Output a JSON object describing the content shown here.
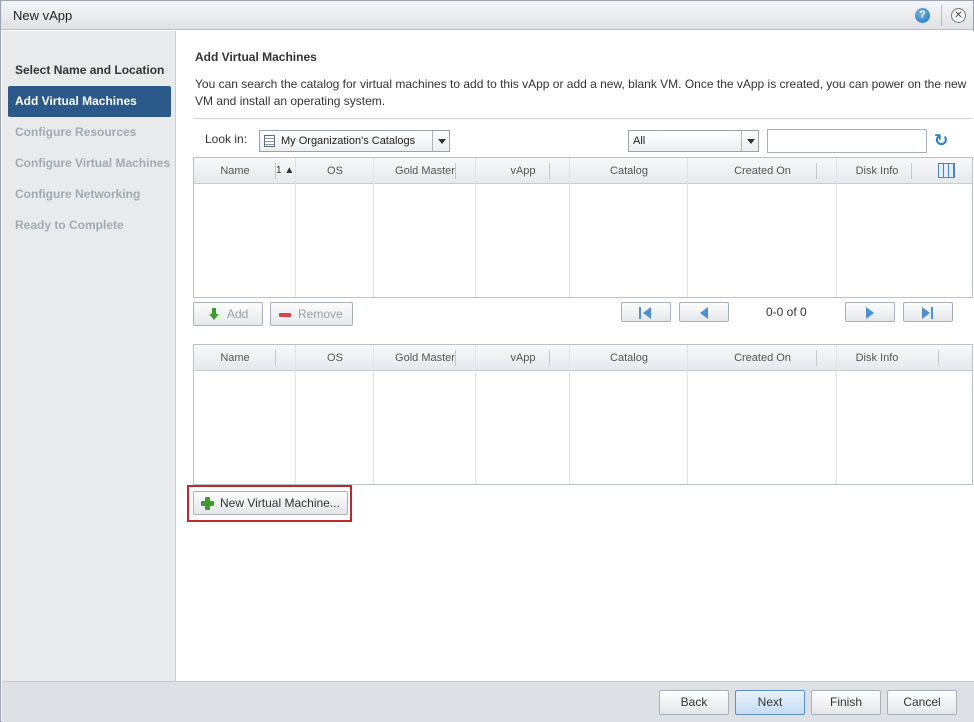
{
  "window": {
    "title": "New vApp",
    "help_label": "?",
    "close_label": "✕"
  },
  "steps": [
    {
      "label": "Select Name and Location",
      "state": "done"
    },
    {
      "label": "Add Virtual Machines",
      "state": "active"
    },
    {
      "label": "Configure Resources",
      "state": "pending"
    },
    {
      "label": "Configure Virtual Machines",
      "state": "pending"
    },
    {
      "label": "Configure Networking",
      "state": "pending"
    },
    {
      "label": "Ready to Complete",
      "state": "pending"
    }
  ],
  "main": {
    "title": "Add Virtual Machines",
    "description": "You can search the catalog for virtual machines to add to this vApp or add a new, blank VM. Once the vApp is created, you can power on the new VM and install an operating system.",
    "look_in_label": "Look in:",
    "look_in_value": "My Organization's Catalogs",
    "filter_value": "All",
    "search_value": "",
    "catalog_grid": {
      "columns": [
        "Name",
        "OS",
        "Gold Master",
        "vApp",
        "Catalog",
        "Created On",
        "Disk Info"
      ],
      "sort_indicator": "1 ▲",
      "rows": []
    },
    "add_label": "Add",
    "remove_label": "Remove",
    "pager_text": "0-0 of 0",
    "selected_grid": {
      "columns": [
        "Name",
        "OS",
        "Gold Master",
        "vApp",
        "Catalog",
        "Created On",
        "Disk Info"
      ],
      "rows": []
    },
    "new_vm_label": "New Virtual Machine..."
  },
  "footer": {
    "back": "Back",
    "next": "Next",
    "finish": "Finish",
    "cancel": "Cancel"
  },
  "colors": {
    "active_step": "#2b5a8a",
    "highlight": "#c0282d",
    "accent": "#1d7fd1"
  }
}
